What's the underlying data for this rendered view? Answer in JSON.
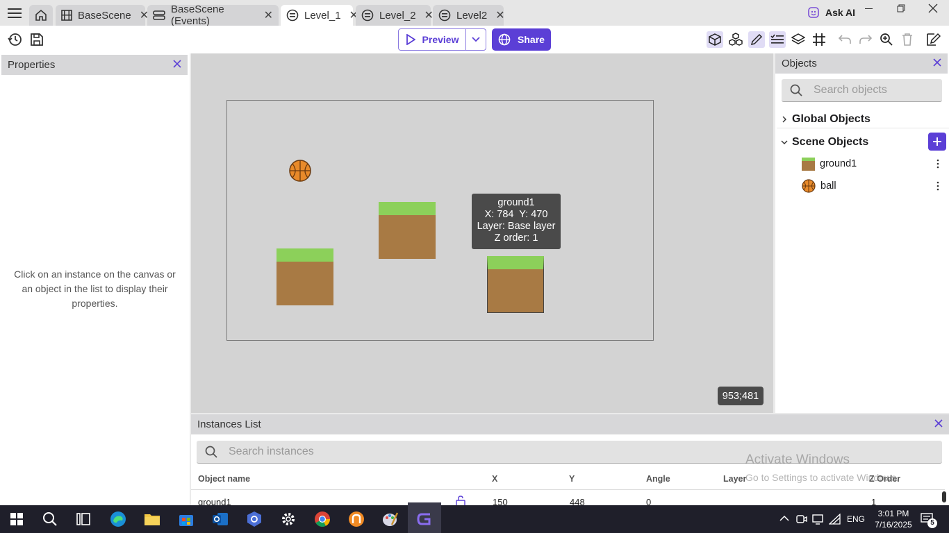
{
  "tabs": [
    {
      "label": "",
      "icon": "home-icon"
    },
    {
      "label": "BaseScene",
      "icon": "film-icon"
    },
    {
      "label": "BaseScene (Events)",
      "icon": "events-icon"
    },
    {
      "label": "Level_1",
      "icon": "scene-icon",
      "active": true
    },
    {
      "label": "Level_2",
      "icon": "scene-icon"
    },
    {
      "label": "Level2",
      "icon": "scene-icon"
    }
  ],
  "ask_ai": "Ask AI",
  "toolbar": {
    "preview_label": "Preview",
    "share_label": "Share",
    "accent": "#5b3fd6"
  },
  "properties": {
    "title": "Properties",
    "empty_text": "Click on an instance on the canvas or an object in the list to display their properties."
  },
  "canvas": {
    "tooltip": {
      "name": "ground1",
      "position": "X: 784  Y: 470",
      "layer": "Layer: Base layer",
      "z_order": "Z order: 1"
    },
    "cursor_coords": "953;481"
  },
  "objects": {
    "title": "Objects",
    "search_placeholder": "Search objects",
    "global_label": "Global Objects",
    "scene_label": "Scene Objects",
    "items": [
      {
        "name": "ground1",
        "icon": "ground-sprite-icon"
      },
      {
        "name": "ball",
        "icon": "basketball-icon"
      }
    ]
  },
  "instances": {
    "title": "Instances List",
    "search_placeholder": "Search instances",
    "columns": [
      "Object name",
      "X",
      "Y",
      "Angle",
      "Layer",
      "Z Order"
    ],
    "rows": [
      {
        "name": "ground1",
        "x": "150",
        "y": "448",
        "angle": "0",
        "layer": "",
        "z": "1"
      }
    ]
  },
  "watermark": {
    "line1": "Activate Windows",
    "line2": "Go to Settings to activate Windows."
  },
  "taskbar": {
    "lang": "ENG",
    "time": "3:01 PM",
    "date": "7/16/2025",
    "notif_count": "5"
  }
}
